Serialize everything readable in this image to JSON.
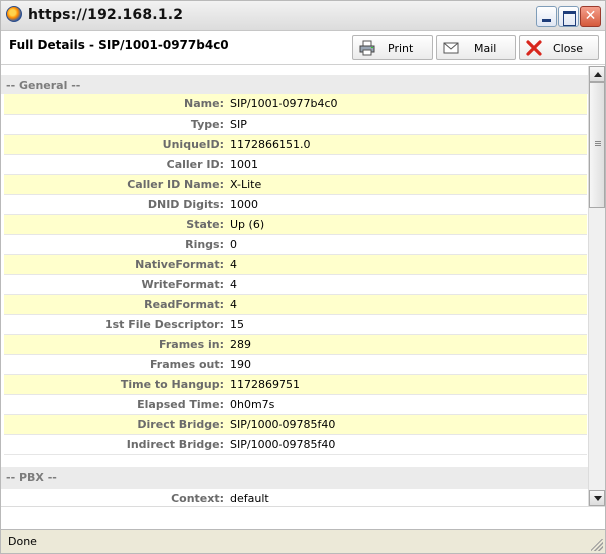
{
  "window": {
    "title": "https://192.168.1.2"
  },
  "header": {
    "page_title": "Full Details - SIP/1001-0977b4c0",
    "buttons": {
      "print_label": "Print",
      "mail_label": "Mail",
      "close_label": "Close"
    }
  },
  "sections": {
    "general_label": "-- General --",
    "pbx_label": "-- PBX --"
  },
  "general_rows": [
    {
      "key": "Name:",
      "value": "SIP/1001-0977b4c0"
    },
    {
      "key": "Type:",
      "value": "SIP"
    },
    {
      "key": "UniqueID:",
      "value": "1172866151.0"
    },
    {
      "key": "Caller ID:",
      "value": "1001"
    },
    {
      "key": "Caller ID Name:",
      "value": "X-Lite"
    },
    {
      "key": "DNID Digits:",
      "value": "1000"
    },
    {
      "key": "State:",
      "value": "Up (6)"
    },
    {
      "key": "Rings:",
      "value": "0"
    },
    {
      "key": "NativeFormat:",
      "value": "4"
    },
    {
      "key": "WriteFormat:",
      "value": "4"
    },
    {
      "key": "ReadFormat:",
      "value": "4"
    },
    {
      "key": "1st File Descriptor:",
      "value": "15"
    },
    {
      "key": "Frames in:",
      "value": "289"
    },
    {
      "key": "Frames out:",
      "value": "190"
    },
    {
      "key": "Time to Hangup:",
      "value": "1172869751"
    },
    {
      "key": "Elapsed Time:",
      "value": "0h0m7s"
    },
    {
      "key": "Direct Bridge:",
      "value": "SIP/1000-09785f40"
    },
    {
      "key": "Indirect Bridge:",
      "value": "SIP/1000-09785f40"
    }
  ],
  "pbx_rows": [
    {
      "key": "Context:",
      "value": "default"
    }
  ],
  "status": {
    "text": "Done"
  },
  "colors": {
    "row_highlight": "#ffffcc",
    "label_gray": "#6b6b6b",
    "close_red": "#d8261c"
  }
}
